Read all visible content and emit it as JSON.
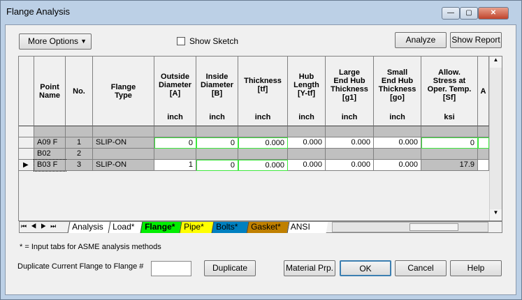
{
  "window": {
    "title": "Flange Analysis",
    "minimize": "—",
    "maximize": "▢",
    "close": "✕"
  },
  "toolbar": {
    "more_options": "More Options",
    "show_sketch": "Show Sketch",
    "show_sketch_checked": false,
    "analyze": "Analyze",
    "show_report": "Show Report"
  },
  "grid": {
    "columns": [
      {
        "title": "Point\nName",
        "unit": ""
      },
      {
        "title": "No.",
        "unit": ""
      },
      {
        "title": "Flange\nType",
        "unit": ""
      },
      {
        "title": "Outside\nDiameter\n[A]",
        "unit": "inch"
      },
      {
        "title": "Inside\nDiameter\n[B]",
        "unit": "inch"
      },
      {
        "title": "Thickness\n[tf]",
        "unit": "inch"
      },
      {
        "title": "Hub\nLength\n[Y-tf]",
        "unit": "inch"
      },
      {
        "title": "Large\nEnd Hub\nThickness\n[g1]",
        "unit": "inch"
      },
      {
        "title": "Small\nEnd Hub\nThickness\n[go]",
        "unit": "inch"
      },
      {
        "title": "Allow.\nStress at\nOper. Temp.\n[Sf]",
        "unit": "ksi"
      },
      {
        "title": "A",
        "unit": ""
      }
    ],
    "rows": [
      [
        "A09 F",
        "1",
        "SLIP-ON",
        "0",
        "0",
        "0.000",
        "0.000",
        "0.000",
        "0.000",
        "0"
      ],
      [
        "B02",
        "2",
        "",
        "",
        "",
        "",
        "",
        "",
        "",
        ""
      ],
      [
        "B03 F",
        "3",
        "SLIP-ON",
        "1",
        "0",
        "0.000",
        "0.000",
        "0.000",
        "0.000",
        "17.9"
      ]
    ],
    "current_row": 2
  },
  "tabs": [
    {
      "label": "Analysis",
      "color": "#ffffff"
    },
    {
      "label": "Load*",
      "color": "#ffffff"
    },
    {
      "label": "Flange*",
      "color": "#00ee00",
      "active": true
    },
    {
      "label": "Pipe*",
      "color": "#ffff00"
    },
    {
      "label": "Bolts*",
      "color": "#0080c0"
    },
    {
      "label": "Gasket*",
      "color": "#c08000"
    },
    {
      "label": "ANSI Che",
      "color": "#ffffff"
    }
  ],
  "footnote": "* = Input tabs for ASME analysis methods",
  "duplicate": {
    "label": "Duplicate Current Flange to Flange #",
    "value": "",
    "button": "Duplicate"
  },
  "buttons": {
    "material": "Material Prp.",
    "ok": "OK",
    "cancel": "Cancel",
    "help": "Help"
  }
}
